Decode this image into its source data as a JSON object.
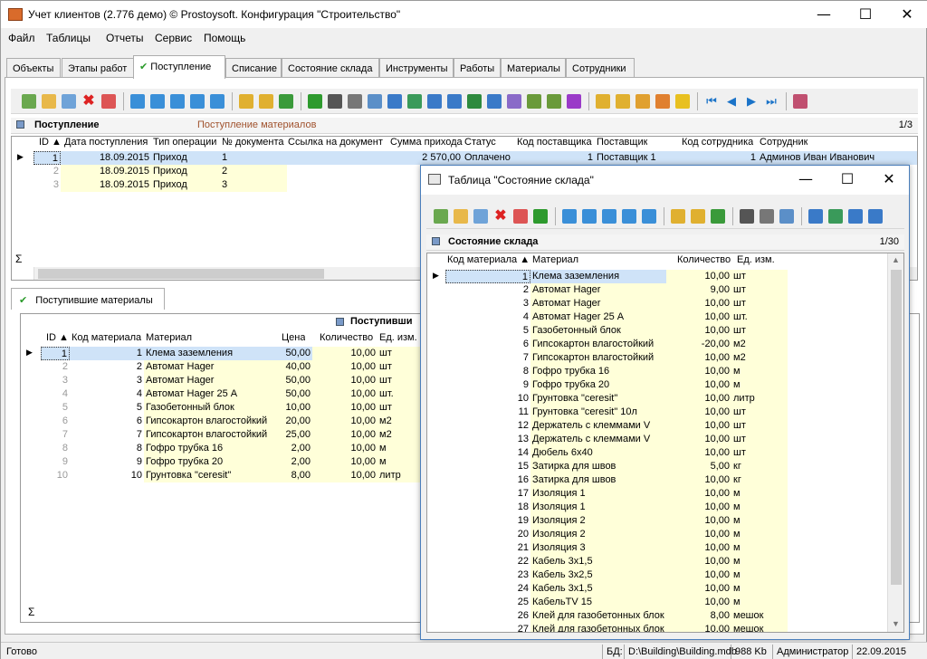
{
  "window": {
    "title": "Учет клиентов (2.776 демо) © Prostoysoft. Конфигурация \"Строительство\"",
    "min": "—",
    "max": "☐",
    "close": "✕"
  },
  "menu": [
    "Файл",
    "Таблицы",
    "Отчеты",
    "Сервис",
    "Помощь"
  ],
  "tabs": [
    "Объекты",
    "Этапы работ",
    "Поступление",
    "Списание",
    "Состояние склада",
    "Инструменты",
    "Работы",
    "Материалы",
    "Сотрудники"
  ],
  "active_tab_check": "✔",
  "receipts": {
    "title": "Поступление",
    "subtitle": "Поступление материалов",
    "counter": "1/3",
    "columns": [
      "ID",
      "Дата поступления",
      "Тип операции",
      "№ документа",
      "Ссылка на документ",
      "Сумма прихода",
      "Статус",
      "Код поставщика",
      "Поставщик",
      "Код сотрудника",
      "Сотрудник"
    ],
    "rows": [
      {
        "id": "1",
        "date": "18.09.2015",
        "type": "Приход",
        "doc": "1",
        "sum": "2 570,00",
        "status": "Оплачено",
        "supcode": "1",
        "supplier": "Поставщик 1",
        "empcode": "1",
        "employee": "Админов Иван Иванович"
      },
      {
        "id": "2",
        "date": "18.09.2015",
        "type": "Приход",
        "doc": "2"
      },
      {
        "id": "3",
        "date": "18.09.2015",
        "type": "Приход",
        "doc": "3"
      }
    ],
    "sigma": "Σ"
  },
  "materials_tab": {
    "check": "✔",
    "label": "Поступившие материалы",
    "header": "Поступивши"
  },
  "materials": {
    "columns": [
      "ID",
      "Код материала",
      "Материал",
      "Цена",
      "Количество",
      "Ед. изм."
    ],
    "rows": [
      {
        "id": "1",
        "code": "1",
        "name": "Клема заземления",
        "price": "50,00",
        "qty": "10,00",
        "unit": "шт"
      },
      {
        "id": "2",
        "code": "2",
        "name": "Автомат Hager",
        "price": "40,00",
        "qty": "10,00",
        "unit": "шт"
      },
      {
        "id": "3",
        "code": "3",
        "name": "Автомат Hager",
        "price": "50,00",
        "qty": "10,00",
        "unit": "шт"
      },
      {
        "id": "4",
        "code": "4",
        "name": "Автомат Hager 25 А",
        "price": "50,00",
        "qty": "10,00",
        "unit": "шт."
      },
      {
        "id": "5",
        "code": "5",
        "name": "Газобетонный блок",
        "price": "10,00",
        "qty": "10,00",
        "unit": "шт"
      },
      {
        "id": "6",
        "code": "6",
        "name": "Гипсокартон влагостойкий",
        "price": "20,00",
        "qty": "10,00",
        "unit": "м2"
      },
      {
        "id": "7",
        "code": "7",
        "name": "Гипсокартон влагостойкий",
        "price": "25,00",
        "qty": "10,00",
        "unit": "м2"
      },
      {
        "id": "8",
        "code": "8",
        "name": "Гофро трубка 16",
        "price": "2,00",
        "qty": "10,00",
        "unit": "м"
      },
      {
        "id": "9",
        "code": "9",
        "name": "Гофро трубка 20",
        "price": "2,00",
        "qty": "10,00",
        "unit": "м"
      },
      {
        "id": "10",
        "code": "10",
        "name": "Грунтовка \"ceresit\"",
        "price": "8,00",
        "qty": "10,00",
        "unit": "литр"
      }
    ],
    "sigma": "Σ"
  },
  "popup": {
    "title": "Таблица \"Состояние склада\"",
    "grid_title": "Состояние склада",
    "counter": "1/30",
    "columns": [
      "Код материала",
      "Материал",
      "Количество",
      "Ед. изм."
    ],
    "rows": [
      {
        "code": "1",
        "name": "Клема заземления",
        "qty": "10,00",
        "unit": "шт"
      },
      {
        "code": "2",
        "name": "Автомат Hager",
        "qty": "9,00",
        "unit": "шт"
      },
      {
        "code": "3",
        "name": "Автомат Hager",
        "qty": "10,00",
        "unit": "шт"
      },
      {
        "code": "4",
        "name": "Автомат Hager 25 А",
        "qty": "10,00",
        "unit": "шт."
      },
      {
        "code": "5",
        "name": "Газобетонный блок",
        "qty": "10,00",
        "unit": "шт"
      },
      {
        "code": "6",
        "name": "Гипсокартон влагостойкий",
        "qty": "-20,00",
        "unit": "м2"
      },
      {
        "code": "7",
        "name": "Гипсокартон влагостойкий",
        "qty": "10,00",
        "unit": "м2"
      },
      {
        "code": "8",
        "name": "Гофро трубка 16",
        "qty": "10,00",
        "unit": "м"
      },
      {
        "code": "9",
        "name": "Гофро трубка 20",
        "qty": "10,00",
        "unit": "м"
      },
      {
        "code": "10",
        "name": "Грунтовка \"ceresit\"",
        "qty": "10,00",
        "unit": "литр"
      },
      {
        "code": "11",
        "name": "Грунтовка \"ceresit\" 10л",
        "qty": "10,00",
        "unit": "шт"
      },
      {
        "code": "12",
        "name": "Держатель с клеммами V",
        "qty": "10,00",
        "unit": "шт"
      },
      {
        "code": "13",
        "name": "Держатель с клеммами V",
        "qty": "10,00",
        "unit": "шт"
      },
      {
        "code": "14",
        "name": "Дюбель 6х40",
        "qty": "10,00",
        "unit": "шт"
      },
      {
        "code": "15",
        "name": "Затирка для швов",
        "qty": "5,00",
        "unit": "кг"
      },
      {
        "code": "16",
        "name": "Затирка для швов",
        "qty": "10,00",
        "unit": "кг"
      },
      {
        "code": "17",
        "name": "Изоляция 1",
        "qty": "10,00",
        "unit": "м"
      },
      {
        "code": "18",
        "name": "Изоляция 1",
        "qty": "10,00",
        "unit": "м"
      },
      {
        "code": "19",
        "name": "Изоляция 2",
        "qty": "10,00",
        "unit": "м"
      },
      {
        "code": "20",
        "name": "Изоляция 2",
        "qty": "10,00",
        "unit": "м"
      },
      {
        "code": "21",
        "name": "Изоляция 3",
        "qty": "10,00",
        "unit": "м"
      },
      {
        "code": "22",
        "name": "Кабель 3х1,5",
        "qty": "10,00",
        "unit": "м"
      },
      {
        "code": "23",
        "name": "Кабель 3х2,5",
        "qty": "10,00",
        "unit": "м"
      },
      {
        "code": "24",
        "name": "Кабель 3х1,5",
        "qty": "10,00",
        "unit": "м"
      },
      {
        "code": "25",
        "name": "КабельTV 15",
        "qty": "10,00",
        "unit": "м"
      },
      {
        "code": "26",
        "name": "Клей для газобетонных блок",
        "qty": "8,00",
        "unit": "мешок"
      },
      {
        "code": "27",
        "name": "Клей для газобетонных блок",
        "qty": "10,00",
        "unit": "мешок"
      }
    ]
  },
  "status": {
    "ready": "Готово",
    "db_label": "БД:",
    "db_path": "D:\\Building\\Building.mdb",
    "size": "988 Kb",
    "user": "Администратор",
    "date": "22.09.2015"
  },
  "colors": {
    "yellow_cell": "#ffffd9",
    "selection": "#cfe3f8",
    "accent": "#1a73c8"
  }
}
